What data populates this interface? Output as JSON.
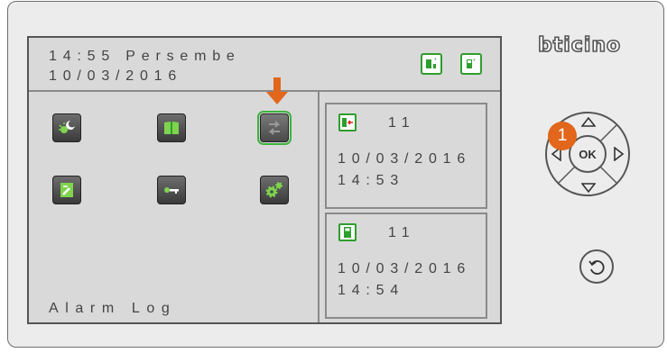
{
  "header": {
    "time_day": "14:55 Persembe",
    "date": "10/03/2016"
  },
  "footer": {
    "title": "Alarm Log"
  },
  "brand": {
    "logo": "bticino"
  },
  "logs": [
    {
      "number": "11",
      "date": "10/03/2016",
      "time": "14:53",
      "icon": "intercom-alarm-icon"
    },
    {
      "number": "11",
      "date": "10/03/2016",
      "time": "14:54",
      "icon": "entrance-panel-icon"
    }
  ],
  "badge": {
    "number": "1"
  },
  "controls": {
    "ok_label": "OK"
  },
  "colors": {
    "accent_green": "#3fb23f",
    "highlight_orange": "#e2661b"
  }
}
